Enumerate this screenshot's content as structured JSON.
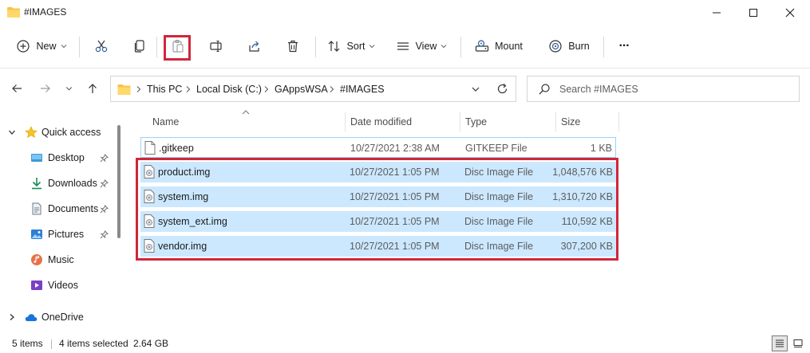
{
  "window": {
    "title": "#IMAGES",
    "folder_color": "#f6c445"
  },
  "toolbar": {
    "new_label": "New",
    "sort_label": "Sort",
    "view_label": "View",
    "mount_label": "Mount",
    "burn_label": "Burn",
    "more_label": "···"
  },
  "address": {
    "crumbs": [
      "This PC",
      "Local Disk (C:)",
      "GAppsWSA",
      "#IMAGES"
    ]
  },
  "search": {
    "placeholder": "Search #IMAGES"
  },
  "nav": {
    "items": [
      {
        "label": "Quick access",
        "icon": "star-icon"
      },
      {
        "label": "Desktop",
        "icon": "desktop-icon",
        "pinned": true
      },
      {
        "label": "Downloads",
        "icon": "download-icon",
        "pinned": true
      },
      {
        "label": "Documents",
        "icon": "document-icon",
        "pinned": true
      },
      {
        "label": "Pictures",
        "icon": "picture-icon",
        "pinned": true
      },
      {
        "label": "Music",
        "icon": "music-icon"
      },
      {
        "label": "Videos",
        "icon": "video-icon"
      },
      {
        "label": "OneDrive",
        "icon": "cloud-icon"
      }
    ]
  },
  "columns": {
    "name": "Name",
    "date": "Date modified",
    "type": "Type",
    "size": "Size"
  },
  "files": [
    {
      "name": ".gitkeep",
      "date": "10/27/2021 2:38 AM",
      "type": "GITKEEP File",
      "size": "1 KB",
      "selected": false
    },
    {
      "name": "product.img",
      "date": "10/27/2021 1:05 PM",
      "type": "Disc Image File",
      "size": "1,048,576 KB",
      "selected": true
    },
    {
      "name": "system.img",
      "date": "10/27/2021 1:05 PM",
      "type": "Disc Image File",
      "size": "1,310,720 KB",
      "selected": true
    },
    {
      "name": "system_ext.img",
      "date": "10/27/2021 1:05 PM",
      "type": "Disc Image File",
      "size": "110,592 KB",
      "selected": true
    },
    {
      "name": "vendor.img",
      "date": "10/27/2021 1:05 PM",
      "type": "Disc Image File",
      "size": "307,200 KB",
      "selected": true
    }
  ],
  "status": {
    "item_count": "5 items",
    "selected": "4 items selected",
    "selected_size": "2.64 GB"
  },
  "colors": {
    "selection": "#cce8ff",
    "highlight": "#d0263a",
    "accent": "#0067c0"
  }
}
